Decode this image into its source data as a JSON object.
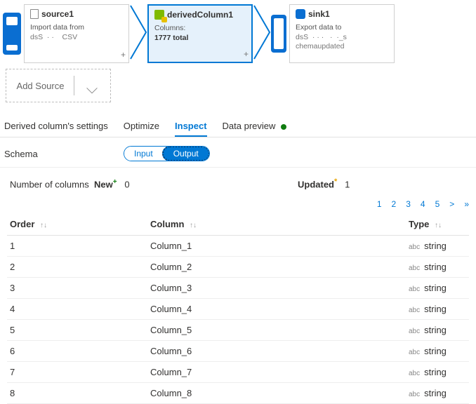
{
  "flow": {
    "source": {
      "name": "source1",
      "desc1": "Import data from",
      "desc2_prefix": "dsS",
      "desc2_suffix": "CSV"
    },
    "derived": {
      "name": "derivedColumn1",
      "label": "Columns:",
      "value": "1777 total"
    },
    "sink": {
      "name": "sink1",
      "desc1": "Export data to",
      "desc2_prefix": "dsS",
      "desc2_mid": "",
      "desc3": "chemaupdated"
    }
  },
  "add_source_label": "Add Source",
  "tabs": {
    "settings": "Derived column's settings",
    "optimize": "Optimize",
    "inspect": "Inspect",
    "preview": "Data preview"
  },
  "schema": {
    "label": "Schema",
    "input": "Input",
    "output": "Output"
  },
  "stats": {
    "num_cols_label": "Number of columns",
    "new_label": "New",
    "new_count": "0",
    "updated_label": "Updated",
    "updated_count": "1"
  },
  "pager": [
    "1",
    "2",
    "3",
    "4",
    "5",
    ">",
    "»"
  ],
  "table": {
    "headers": {
      "order": "Order",
      "column": "Column",
      "type": "Type"
    },
    "type_prefix": "abc",
    "rows": [
      {
        "order": "1",
        "column": "Column_1",
        "type": "string"
      },
      {
        "order": "2",
        "column": "Column_2",
        "type": "string"
      },
      {
        "order": "3",
        "column": "Column_3",
        "type": "string"
      },
      {
        "order": "4",
        "column": "Column_4",
        "type": "string"
      },
      {
        "order": "5",
        "column": "Column_5",
        "type": "string"
      },
      {
        "order": "6",
        "column": "Column_6",
        "type": "string"
      },
      {
        "order": "7",
        "column": "Column_7",
        "type": "string"
      },
      {
        "order": "8",
        "column": "Column_8",
        "type": "string"
      }
    ]
  }
}
